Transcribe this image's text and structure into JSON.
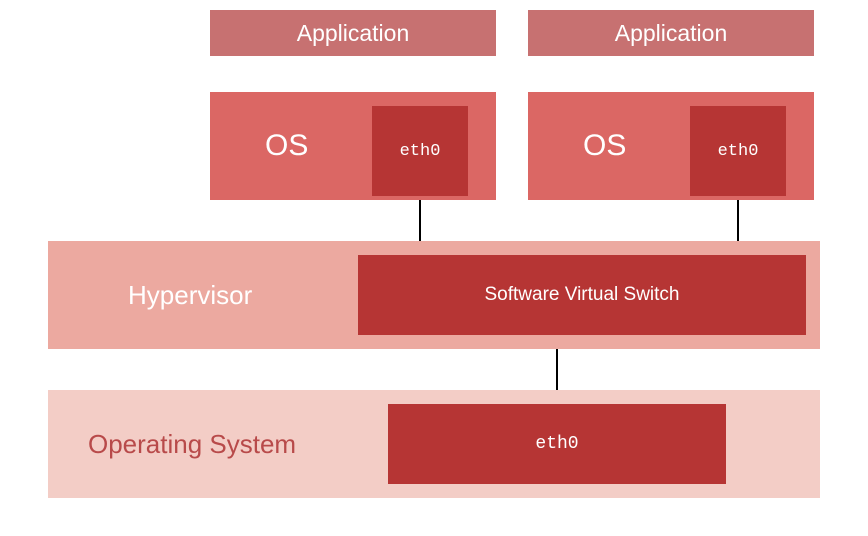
{
  "colors": {
    "app_bg": "#c77171",
    "os_bg": "#db6764",
    "eth_bg": "#b63534",
    "hypervisor_bg": "#eca9a0",
    "svs_bg": "#b63534",
    "os_bottom_bg": "#f3cdc6",
    "eth_bottom_bg": "#b63534"
  },
  "top": {
    "app1": "Application",
    "app2": "Application"
  },
  "vm": {
    "os1": "OS",
    "eth1": "eth0",
    "os2": "OS",
    "eth2": "eth0"
  },
  "hypervisor": {
    "label": "Hypervisor",
    "switch": "Software Virtual Switch"
  },
  "host": {
    "label": "Operating System",
    "eth": "eth0"
  }
}
